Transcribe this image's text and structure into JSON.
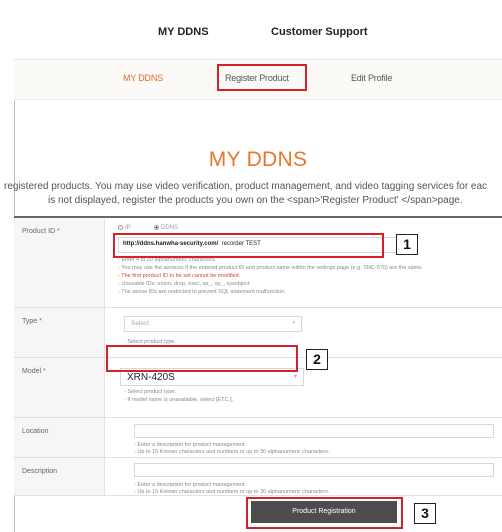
{
  "top_nav": {
    "my_ddns": "MY DDNS",
    "customer_support": "Customer Support"
  },
  "sub_nav": {
    "my_ddns": "MY DDNS",
    "register_product": "Register Product",
    "edit_profile": "Edit Profile"
  },
  "heading": "MY DDNS",
  "description": {
    "line1": "registered products. You may use video verification, product management, and video tagging services for eac",
    "line2": "is not displayed, register the products you own on the <span>'Register Product' </span>page."
  },
  "form": {
    "product_id": {
      "label": "Product ID",
      "required": "*",
      "radio_ip": "IP",
      "radio_ddns": "DDNS",
      "value_prefix": "http://ddns.hanwha-security.com/",
      "value": "recorder TEST",
      "hints": [
        "- Enter 4 to 20 alphanumeric characters.",
        "- You may use the services if the entered product ID and product name within the settings page (e.g. SNC-570) are the same.",
        "- The first product ID to be set cannot be modified.",
        "- Unusable IDs: union, drop, exec, sp_, xp_, sysobject",
        "  - The above IDs are restricted to prevent SQL statement malfunction."
      ]
    },
    "type": {
      "label": "Type",
      "required": "*",
      "value": "Select",
      "hints": [
        "- Select product type."
      ]
    },
    "model": {
      "label": "Model",
      "required": "*",
      "value": "XRN-420S",
      "hints": [
        "- Select product type.",
        "- If model name is unavailable, select [ETC.]."
      ]
    },
    "location": {
      "label": "Location",
      "value": "",
      "hints": [
        "- Enter a description for product management.",
        "- Up to 15 Korean characters and numbers or up to 30 alphanumeric characters."
      ]
    },
    "description": {
      "label": "Description",
      "value": "",
      "hints": [
        "- Enter a description for product management.",
        "- Up to 15 Korean characters and numbers or up to 30 alphanumeric characters."
      ]
    }
  },
  "submit_label": "Product Registration",
  "callouts": [
    "1",
    "2",
    "3"
  ],
  "colors": {
    "accent": "#e8762d",
    "callout": "#d6202a",
    "button": "#4d4d4d"
  }
}
